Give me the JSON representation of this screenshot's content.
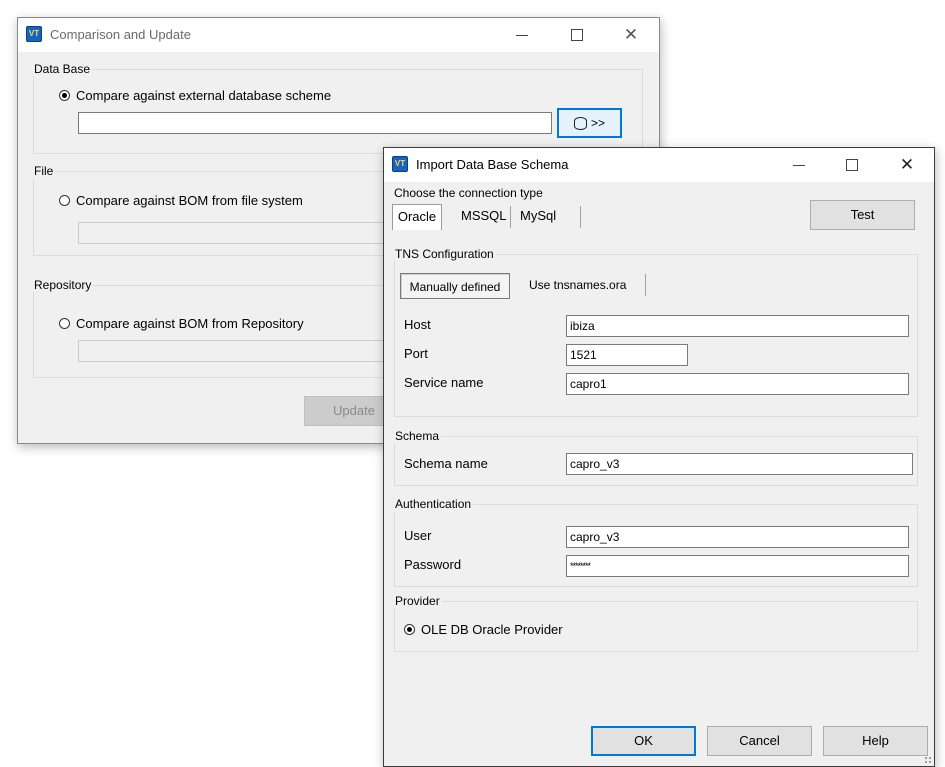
{
  "comparison_window": {
    "title": "Comparison and Update",
    "groups": {
      "database": {
        "legend": "Data Base",
        "option_label": "Compare against external database scheme",
        "selected": true,
        "path_value": "",
        "browse_label": ">>"
      },
      "file": {
        "legend": "File",
        "option_label": "Compare against BOM from file system",
        "selected": false,
        "path_value": ""
      },
      "repository": {
        "legend": "Repository",
        "option_label": "Compare against BOM from Repository",
        "selected": false,
        "path_value": ""
      }
    },
    "update_label": "Update"
  },
  "import_dialog": {
    "title": "Import Data Base Schema",
    "connection_type_label": "Choose the connection type",
    "tabs": [
      {
        "label": "Oracle",
        "selected": true
      },
      {
        "label": "MSSQL",
        "selected": false
      },
      {
        "label": "MySql",
        "selected": false
      }
    ],
    "test_label": "Test",
    "tns": {
      "legend": "TNS Configuration",
      "subtabs": [
        {
          "label": "Manually defined",
          "selected": true
        },
        {
          "label": "Use tnsnames.ora",
          "selected": false
        }
      ],
      "host": {
        "label": "Host",
        "value": "ibiza"
      },
      "port": {
        "label": "Port",
        "value": "1521"
      },
      "service": {
        "label": "Service name",
        "value": "capro1"
      }
    },
    "schema": {
      "legend": "Schema",
      "name": {
        "label": "Schema name",
        "value": "capro_v3"
      }
    },
    "auth": {
      "legend": "Authentication",
      "user": {
        "label": "User",
        "value": "capro_v3"
      },
      "password": {
        "label": "Password",
        "value": "********"
      }
    },
    "provider": {
      "legend": "Provider",
      "option_label": "OLE DB Oracle Provider",
      "selected": true
    },
    "buttons": {
      "ok": "OK",
      "cancel": "Cancel",
      "help": "Help"
    }
  }
}
